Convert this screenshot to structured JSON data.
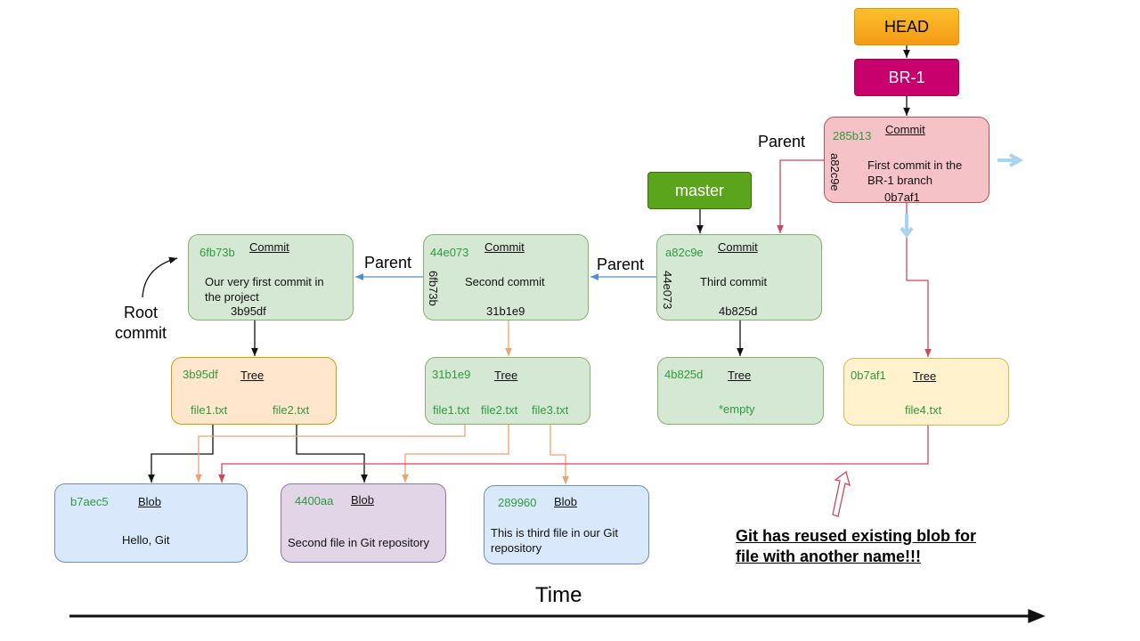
{
  "refs": {
    "head": "HEAD",
    "br1": "BR-1",
    "master": "master"
  },
  "commits": [
    {
      "hash": "6fb73b",
      "kind": "Commit",
      "message": "Our very first commit in the project",
      "tree": "3b95df",
      "parent": ""
    },
    {
      "hash": "44e073",
      "kind": "Commit",
      "message": "Second commit",
      "tree": "31b1e9",
      "parent": "6fb73b"
    },
    {
      "hash": "a82c9e",
      "kind": "Commit",
      "message": "Third commit",
      "tree": "4b825d",
      "parent": "44e073"
    },
    {
      "hash": "285b13",
      "kind": "Commit",
      "message": "First commit in the BR-1 branch",
      "tree": "0b7af1",
      "parent": "a82c9e"
    }
  ],
  "trees": [
    {
      "hash": "3b95df",
      "kind": "Tree",
      "files": [
        "file1.txt",
        "file2.txt"
      ]
    },
    {
      "hash": "31b1e9",
      "kind": "Tree",
      "files": [
        "file1.txt",
        "file2.txt",
        "file3.txt"
      ]
    },
    {
      "hash": "4b825d",
      "kind": "Tree",
      "files": [
        "*empty"
      ]
    },
    {
      "hash": "0b7af1",
      "kind": "Tree",
      "files": [
        "file4.txt"
      ]
    }
  ],
  "blobs": [
    {
      "hash": "b7aec5",
      "kind": "Blob",
      "content": "Hello, Git"
    },
    {
      "hash": "4400aa",
      "kind": "Blob",
      "content": "Second file in Git repository"
    },
    {
      "hash": "289960",
      "kind": "Blob",
      "content": "This is third file in our Git repository"
    }
  ],
  "labels": {
    "parent": "Parent",
    "root_commit": "Root commit",
    "time": "Time",
    "note": "Git has reused existing blob for file with another name!!!"
  },
  "colors": {
    "head": "#f5a623",
    "br1": "#c8006e",
    "master": "#5aa51c",
    "red_edge": "#d0475a",
    "orange_edge": "#eea370",
    "blue_edge": "#4a90d9"
  }
}
